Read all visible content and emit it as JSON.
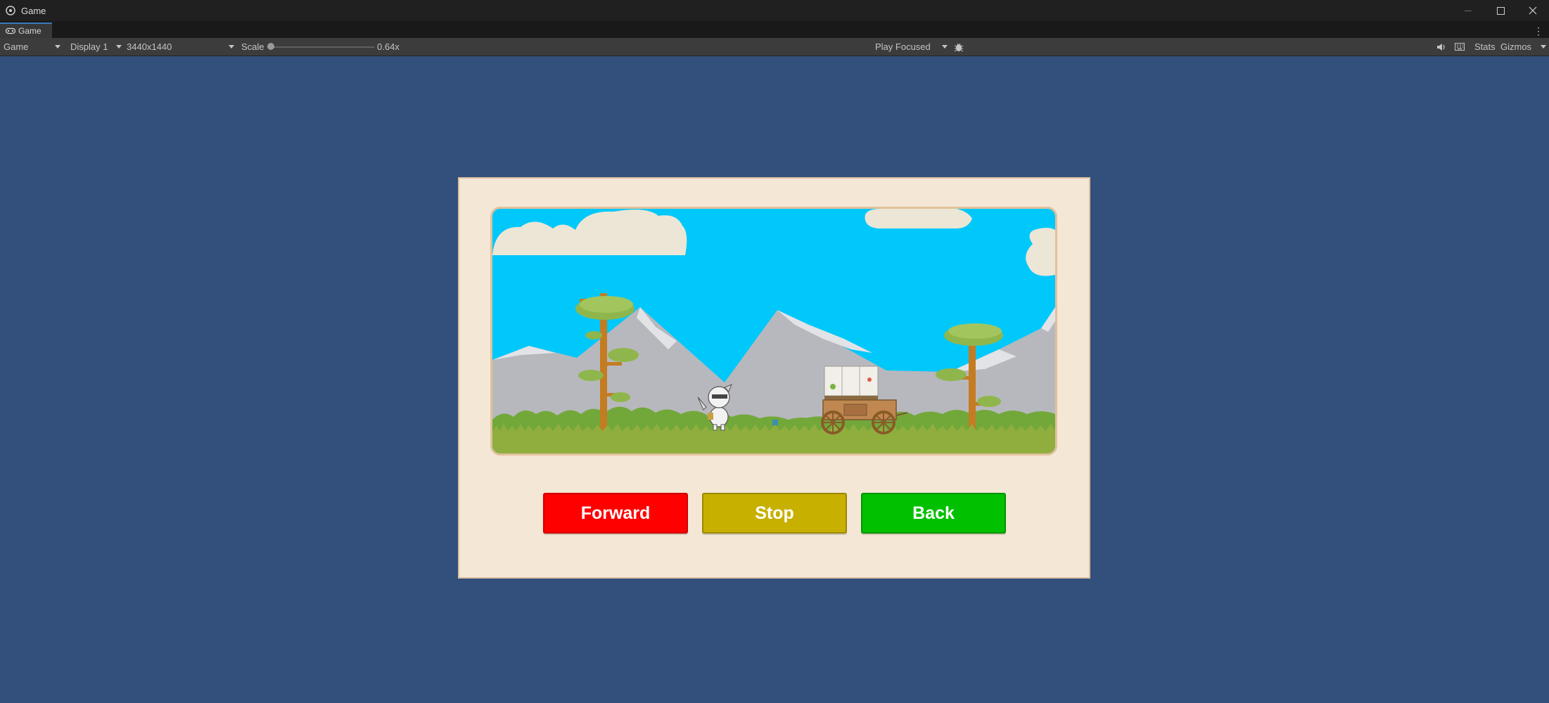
{
  "window": {
    "title": "Game"
  },
  "tab": {
    "label": "Game"
  },
  "toolbar": {
    "view_mode": "Game",
    "display": "Display 1",
    "resolution": "3440x1440",
    "scale_label": "Scale",
    "scale_value": "0.64x",
    "play_mode": "Play Focused",
    "stats": "Stats",
    "gizmos": "Gizmos"
  },
  "buttons": {
    "forward": "Forward",
    "stop": "Stop",
    "back": "Back"
  },
  "colors": {
    "background": "#334f7b",
    "panel": "#f4e7d6",
    "sky": "#00c8fb",
    "forward_button": "#ff0000",
    "stop_button": "#c7b000",
    "back_button": "#00c000"
  }
}
